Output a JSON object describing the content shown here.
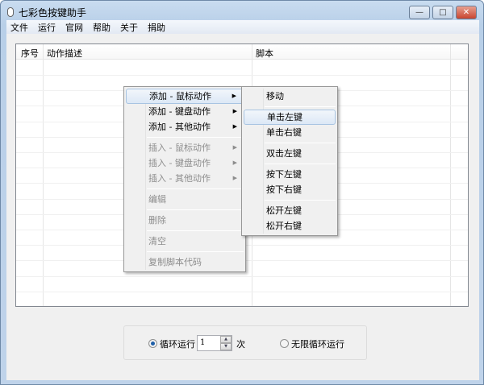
{
  "window": {
    "title": "七彩色按键助手",
    "minimize": "—",
    "maximize": "□",
    "close": "✕"
  },
  "menubar": [
    "文件",
    "运行",
    "官网",
    "帮助",
    "关于",
    "捐助"
  ],
  "table": {
    "columns": [
      "序号",
      "动作描述",
      "脚本"
    ]
  },
  "context_menu": {
    "items": [
      {
        "label": "添加 - 鼠标动作",
        "submenu": true,
        "disabled": false,
        "highlighted": true
      },
      {
        "label": "添加 - 键盘动作",
        "submenu": true,
        "disabled": false
      },
      {
        "label": "添加 - 其他动作",
        "submenu": true,
        "disabled": false
      },
      {
        "label": "插入 - 鼠标动作",
        "submenu": true,
        "disabled": true
      },
      {
        "label": "插入 - 键盘动作",
        "submenu": true,
        "disabled": true
      },
      {
        "label": "插入 - 其他动作",
        "submenu": true,
        "disabled": true
      },
      {
        "label": "编辑",
        "disabled": true
      },
      {
        "label": "删除",
        "disabled": true
      },
      {
        "label": "清空",
        "disabled": true
      },
      {
        "label": "复制脚本代码",
        "disabled": true
      }
    ],
    "submenu_arrow": "▶"
  },
  "submenu": {
    "items": [
      "移动",
      "单击左键",
      "单击右键",
      "双击左键",
      "按下左键",
      "按下右键",
      "松开左键",
      "松开右键"
    ],
    "highlighted": "单击左键"
  },
  "loop": {
    "loop_label": "循环运行",
    "count": "1",
    "times_label": "次",
    "infinite_label": "无限循环运行",
    "selected": "循环运行",
    "spin_up": "▲",
    "spin_down": "▼"
  }
}
